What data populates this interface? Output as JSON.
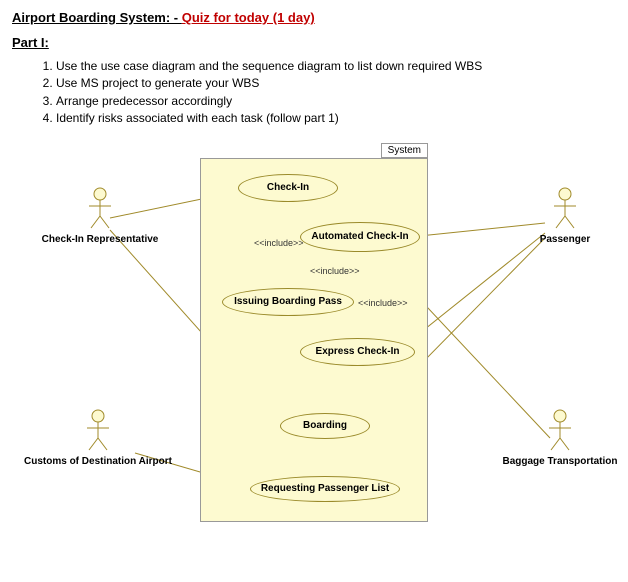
{
  "heading": {
    "title_main": "Airport Boarding System: - ",
    "title_quiz": "Quiz for today (1 day)"
  },
  "part_label": "Part I:",
  "instructions": {
    "items": [
      "Use the use case diagram and the sequence diagram to list down required WBS",
      "Use MS project to generate your WBS",
      "Arrange predecessor accordingly",
      "Identify risks associated with each task (follow part 1)"
    ]
  },
  "diagram": {
    "system_label": "System",
    "actors": {
      "checkin_rep": "Check-In Representative",
      "passenger": "Passenger",
      "customs": "Customs of Destination Airport",
      "baggage": "Baggage Transportation"
    },
    "usecases": {
      "check_in": "Check-In",
      "automated_check_in": "Automated Check-In",
      "issuing_boarding_pass": "Issuing Boarding Pass",
      "express_check_in": "Express Check-In",
      "boarding": "Boarding",
      "requesting_passenger_list": "Requesting Passenger List"
    },
    "relations": {
      "include1": "<<include>>",
      "include2": "<<include>>",
      "include3": "<<include>>"
    }
  }
}
